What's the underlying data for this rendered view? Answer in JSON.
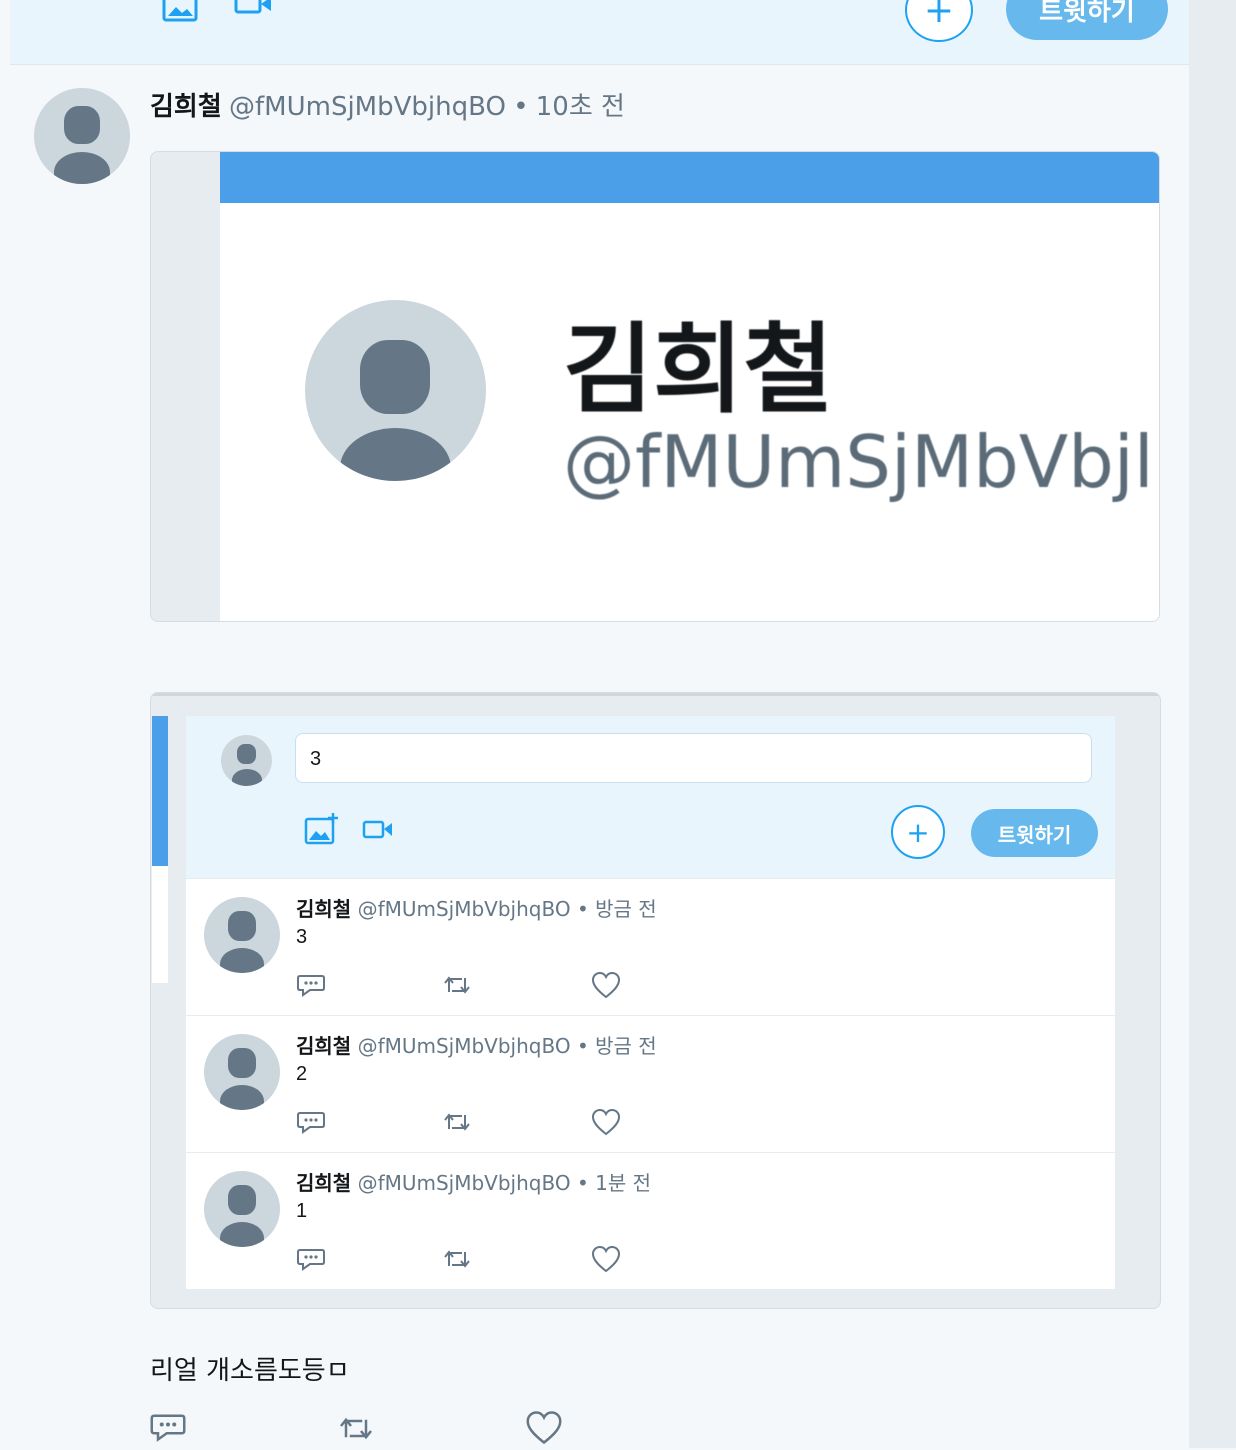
{
  "top_composer": {
    "image_icon": "image-icon",
    "video_icon": "video-icon",
    "plus_label": "+",
    "tweet_label": "트윗하기"
  },
  "tweet": {
    "name": "김희철",
    "handle": "@fMUmSjMbVbjhqBO",
    "separator": "•",
    "time": "10초 전",
    "image_card": {
      "big_name": "김희철",
      "big_handle": "@fMUmSjMbVbjl"
    },
    "screenshot_card": {
      "composer_value": "3",
      "plus_label": "+",
      "tweet_label": "트윗하기",
      "items": [
        {
          "name": "김희철",
          "handle": "@fMUmSjMbVbjhqBO",
          "separator": "•",
          "time": "방금 전",
          "text": "3"
        },
        {
          "name": "김희철",
          "handle": "@fMUmSjMbVbjhqBO",
          "separator": "•",
          "time": "방금 전",
          "text": "2"
        },
        {
          "name": "김희철",
          "handle": "@fMUmSjMbVbjhqBO",
          "separator": "•",
          "time": "1분 전",
          "text": "1"
        }
      ]
    },
    "text": "리얼 개소름도등ㅁ",
    "actions": [
      "reply-icon",
      "retweet-icon",
      "like-icon"
    ]
  },
  "colors": {
    "accent": "#1da1f2",
    "composer_bg": "#e8f5fd",
    "banner": "#4a9fe8"
  }
}
